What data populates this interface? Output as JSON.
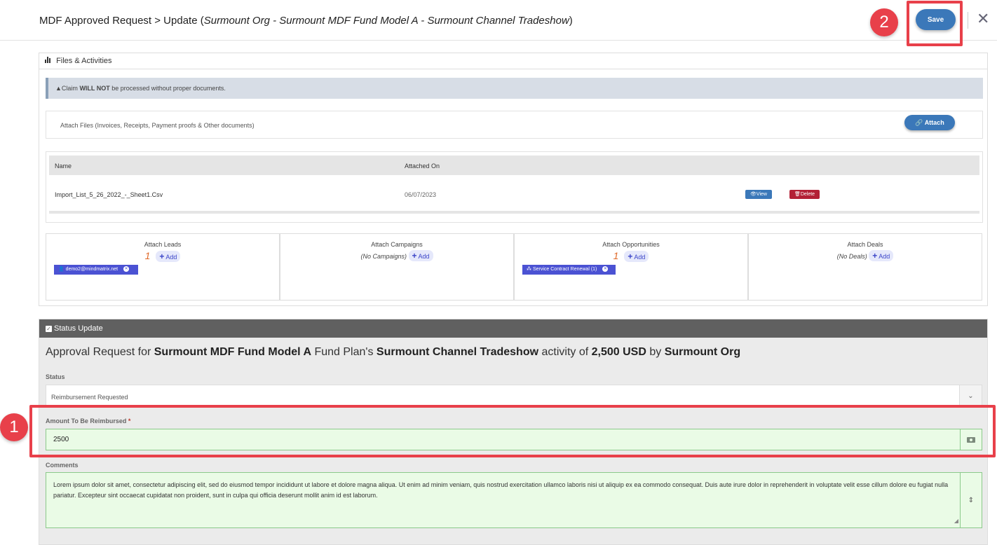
{
  "header": {
    "title_prefix": "MDF Approved Request > Update (",
    "title_italic": "Surmount Org - Surmount MDF Fund Model A - Surmount Channel Tradeshow",
    "title_suffix": ")",
    "save_label": "Save",
    "close_glyph": "✕"
  },
  "annotations": {
    "badge_1": "1",
    "badge_2": "2"
  },
  "files_panel": {
    "title": "Files & Activities",
    "alert_prefix": "Claim ",
    "alert_bold": "WILL NOT",
    "alert_suffix": " be processed without proper documents.",
    "attach_label": "Attach Files (Invoices, Receipts, Payment proofs & Other documents)",
    "attach_button": "Attach",
    "table": {
      "col_name": "Name",
      "col_attached_on": "Attached On",
      "rows": [
        {
          "name": "Import_List_5_26_2022_-_Sheet1.Csv",
          "attached_on": "06/07/2023",
          "view": "View",
          "delete": "Delete"
        }
      ]
    },
    "attach_sections": [
      {
        "title": "Attach Leads",
        "count": "1",
        "none": "",
        "add": "Add",
        "chip": "demo2@mindmatrix.net"
      },
      {
        "title": "Attach Campaigns",
        "count": "",
        "none": "(No Campaigns)",
        "add": "Add",
        "chip": ""
      },
      {
        "title": "Attach Opportunities",
        "count": "1",
        "none": "",
        "add": "Add",
        "chip": "Service Contract Renewal (1)"
      },
      {
        "title": "Attach Deals",
        "count": "",
        "none": "(No Deals)",
        "add": "Add",
        "chip": ""
      }
    ]
  },
  "status_panel": {
    "title": "Status Update",
    "approval": {
      "p1": "Approval Request for ",
      "fund": "Surmount MDF Fund Model A",
      "p2": " Fund Plan's ",
      "activity": "Surmount Channel Tradeshow",
      "p3": " activity of ",
      "amount": "2,500 USD",
      "p4": " by ",
      "org": "Surmount Org"
    },
    "status_label": "Status",
    "status_value": "Reimbursement Requested",
    "amount_label": "Amount To Be Reimbursed",
    "amount_required": "*",
    "amount_value": "2500",
    "comments_label": "Comments",
    "comments_value": "Lorem ipsum dolor sit amet, consectetur adipiscing elit, sed do eiusmod tempor incididunt ut labore et dolore magna aliqua. Ut enim ad minim veniam, quis nostrud exercitation ullamco laboris nisi ut aliquip ex ea commodo consequat. Duis aute irure dolor in reprehenderit in voluptate velit esse cillum dolore eu fugiat nulla pariatur. Excepteur sint occaecat cupidatat non proident, sunt in culpa qui officia deserunt mollit anim id est laborum."
  },
  "colors": {
    "primary": "#3b78b9",
    "danger": "#b32035",
    "highlight": "#e8404a",
    "chip": "#4b52d3"
  }
}
